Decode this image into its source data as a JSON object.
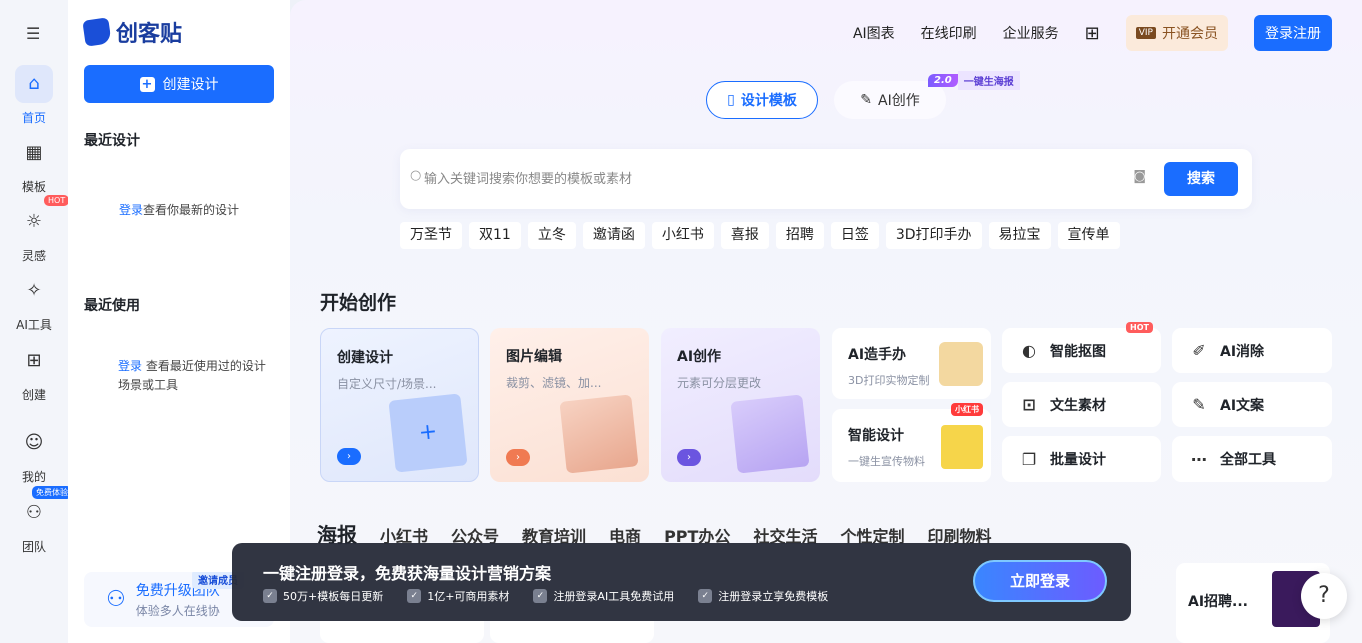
{
  "app": {
    "brand": "创客贴"
  },
  "rail": {
    "items": [
      {
        "label": "首页",
        "icon": "home-icon"
      },
      {
        "label": "模板",
        "icon": "template-icon"
      },
      {
        "label": "灵感",
        "icon": "bulb-icon",
        "badge": "HOT"
      },
      {
        "label": "AI工具",
        "icon": "ai-sparkle-icon"
      },
      {
        "label": "创建",
        "icon": "plus-square-icon"
      },
      {
        "label": "我的",
        "icon": "user-icon"
      },
      {
        "label": "团队",
        "icon": "team-icon",
        "badge": "免费体验"
      }
    ]
  },
  "sidebar": {
    "create_label": "创建设计",
    "recent_design_title": "最近设计",
    "recent_design_login": "登录",
    "recent_design_text": "查看你最新的设计",
    "recent_use_title": "最近使用",
    "recent_use_login": "登录",
    "recent_use_text": "查看最近使用过的设计场景或工具",
    "team_title": "免费升级团队",
    "team_sub": "体验多人在线协",
    "team_badge": "邀请成员"
  },
  "topnav": {
    "items": [
      "AI图表",
      "在线印刷",
      "企业服务"
    ],
    "vip": "开通会员",
    "vip_tag": "VIP",
    "register": "登录注册"
  },
  "modes": {
    "template": "设计模板",
    "ai": "AI创作",
    "badge_version": "2.0",
    "badge_text": "一键生海报"
  },
  "search": {
    "placeholder": "输入关键词搜索你想要的模板或素材",
    "button": "搜索"
  },
  "tags": [
    "万圣节",
    "双11",
    "立冬",
    "邀请函",
    "小红书",
    "喜报",
    "招聘",
    "日签",
    "3D打印手办",
    "易拉宝",
    "宣传单"
  ],
  "start": {
    "title": "开始创作",
    "cards": [
      {
        "title": "创建设计",
        "sub": "自定义尺寸/场景..."
      },
      {
        "title": "图片编辑",
        "sub": "裁剪、滤镜、加..."
      },
      {
        "title": "AI创作",
        "sub": "元素可分层更改"
      }
    ],
    "feature": [
      {
        "title": "AI造手办",
        "sub": "3D打印实物定制"
      },
      {
        "title": "智能设计",
        "sub": "一键生宣传物料",
        "badge": "小红书"
      }
    ],
    "tools": [
      {
        "label": "智能抠图",
        "icon": "cutout-icon",
        "badge": "HOT"
      },
      {
        "label": "AI消除",
        "icon": "eraser-icon"
      },
      {
        "label": "文生素材",
        "icon": "image-plus-icon"
      },
      {
        "label": "AI文案",
        "icon": "pen-icon"
      },
      {
        "label": "批量设计",
        "icon": "layers-icon"
      },
      {
        "label": "全部工具",
        "icon": "more-icon"
      }
    ]
  },
  "categories": [
    "海报",
    "小红书",
    "公众号",
    "教育培训",
    "电商",
    "PPT办公",
    "社交生活",
    "个性定制",
    "印刷物料"
  ],
  "peek": {
    "ai_recruit": "AI招聘..."
  },
  "banner": {
    "title": "一键注册登录，免费获海量设计营销方案",
    "bullets": [
      "50万+模板每日更新",
      "1亿+可商用素材",
      "注册登录AI工具免费试用",
      "注册登录立享免费模板"
    ],
    "login": "立即登录"
  },
  "help": "?"
}
